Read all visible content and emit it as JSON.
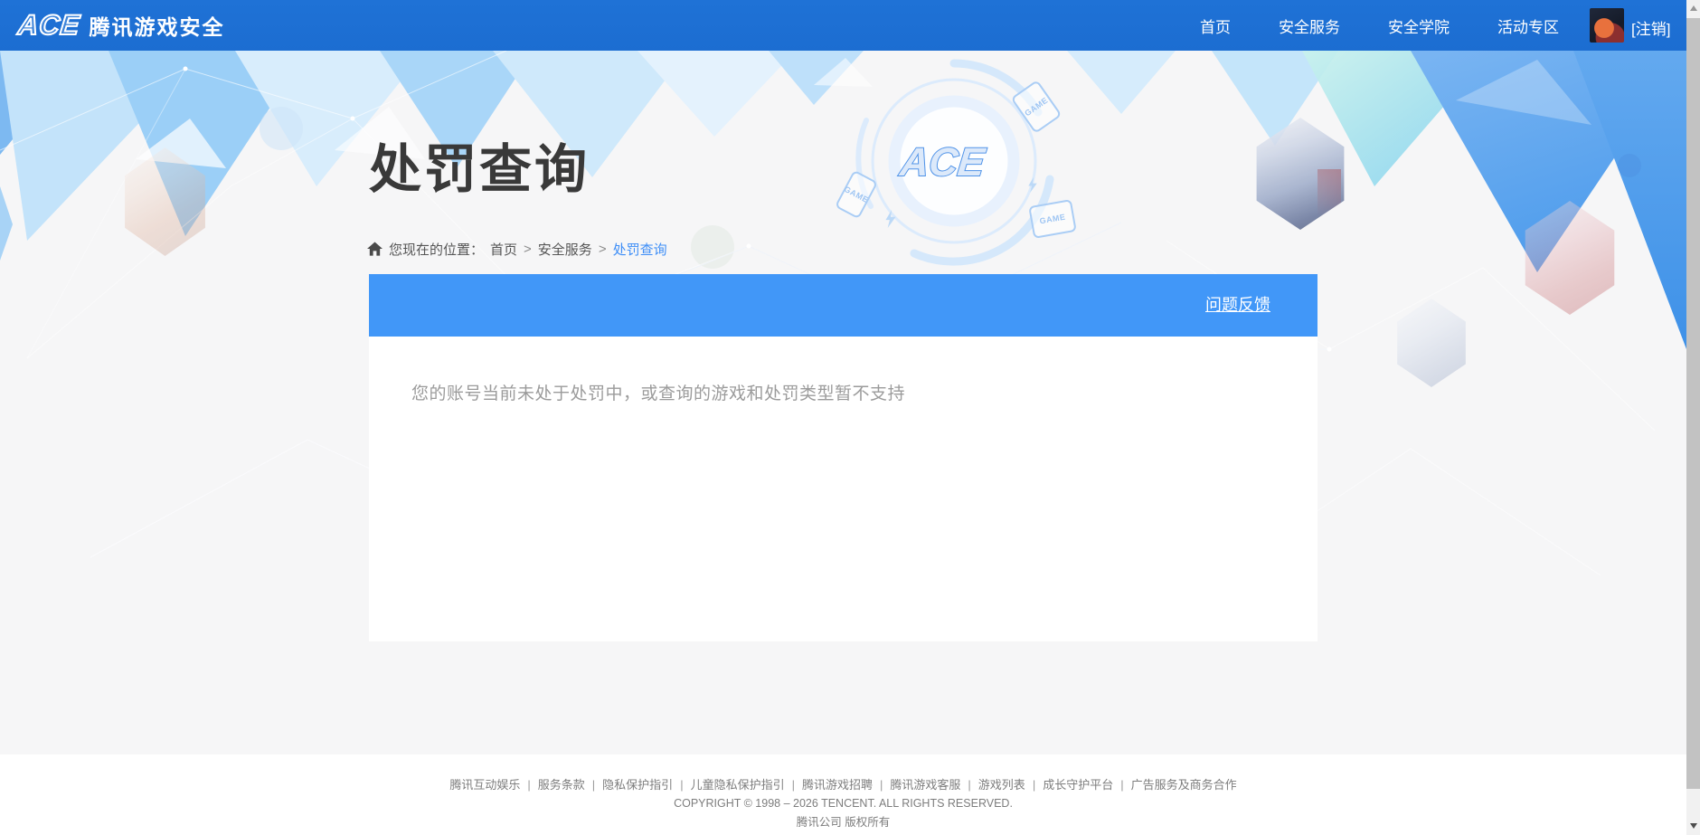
{
  "navbar": {
    "brand": {
      "logo_text": "ACE",
      "title": "腾讯游戏安全"
    },
    "items": [
      "首页",
      "安全服务",
      "安全学院",
      "活动专区"
    ],
    "logout_label": "[注销]"
  },
  "hero": {
    "title": "处罚查询",
    "breadcrumb": {
      "prefix": "您现在的位置：",
      "home": "首页",
      "separator": ">",
      "section": "安全服务",
      "current": "处罚查询"
    },
    "center_logo_text": "ACE",
    "game_chip_label": "GAME"
  },
  "panel": {
    "feedback_link": "问题反馈",
    "message": "您的账号当前未处于处罚中，或查询的游戏和处罚类型暂不支持"
  },
  "footer": {
    "links": [
      "腾讯互动娱乐",
      "服务条款",
      "隐私保护指引",
      "儿童隐私保护指引",
      "腾讯游戏招聘",
      "腾讯游戏客服",
      "游戏列表",
      "成长守护平台",
      "广告服务及商务合作"
    ],
    "separator": "|",
    "copyright": "COPYRIGHT © 1998 – 2026 TENCENT. ALL RIGHTS RESERVED.",
    "company": "腾讯公司 版权所有"
  },
  "colors": {
    "navbar_blue": "#1d6fd3",
    "panel_header_blue": "#4197f8",
    "link_blue": "#3e8ef7",
    "hero_background": "#f6f6f7"
  }
}
